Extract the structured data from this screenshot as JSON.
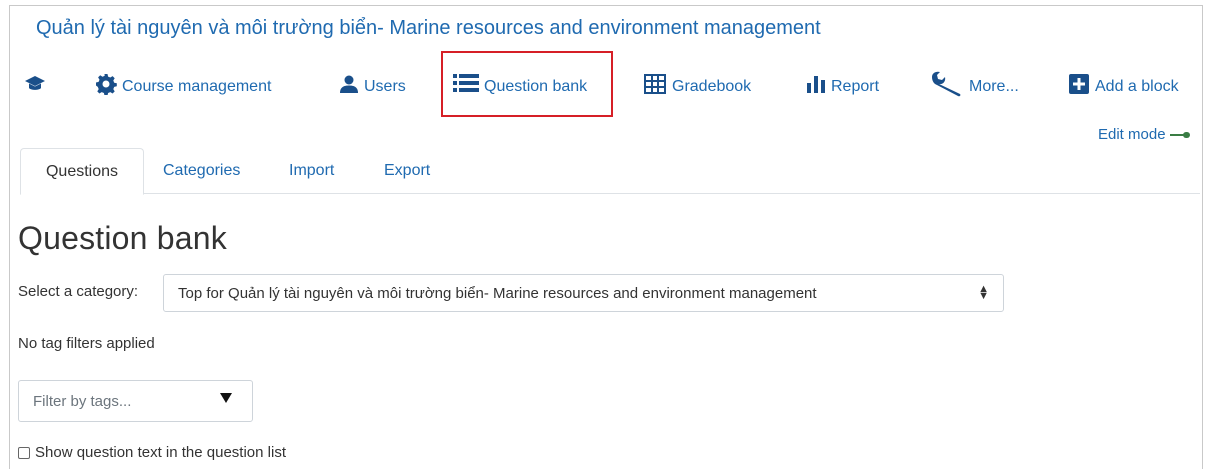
{
  "course": {
    "title": "Quản lý tài nguyên và môi trường biển- Marine resources and environment management"
  },
  "toolbar": {
    "items": [
      {
        "icon": "graduation-cap-icon",
        "label": ""
      },
      {
        "icon": "gear-icon",
        "label": "Course management"
      },
      {
        "icon": "user-icon",
        "label": "Users"
      },
      {
        "icon": "list-icon",
        "label": "Question bank"
      },
      {
        "icon": "table-icon",
        "label": "Gradebook"
      },
      {
        "icon": "bar-chart-icon",
        "label": "Report"
      },
      {
        "icon": "wrench-icon",
        "label": "More..."
      },
      {
        "icon": "plus-square-icon",
        "label": "Add a block"
      }
    ],
    "highlighted": "Question bank",
    "highlight_color": "#d61f26"
  },
  "edit_mode": {
    "label": "Edit mode",
    "enabled": true,
    "toggle_color": "#3a7d44"
  },
  "tabs": [
    {
      "label": "Questions",
      "active": true
    },
    {
      "label": "Categories",
      "active": false
    },
    {
      "label": "Import",
      "active": false
    },
    {
      "label": "Export",
      "active": false
    }
  ],
  "page": {
    "heading": "Question bank"
  },
  "category": {
    "label": "Select a category:",
    "selected": "Top for Quản lý tài nguyên và môi trường biển- Marine resources and environment management"
  },
  "tags": {
    "status": "No tag filters applied",
    "filter_placeholder": "Filter by tags..."
  },
  "options": {
    "show_question_text_label": "Show question text in the question list",
    "show_question_text_checked": false
  },
  "colors": {
    "link": "#1f6ab0",
    "icon": "#1a4f8a",
    "text": "#333333"
  }
}
